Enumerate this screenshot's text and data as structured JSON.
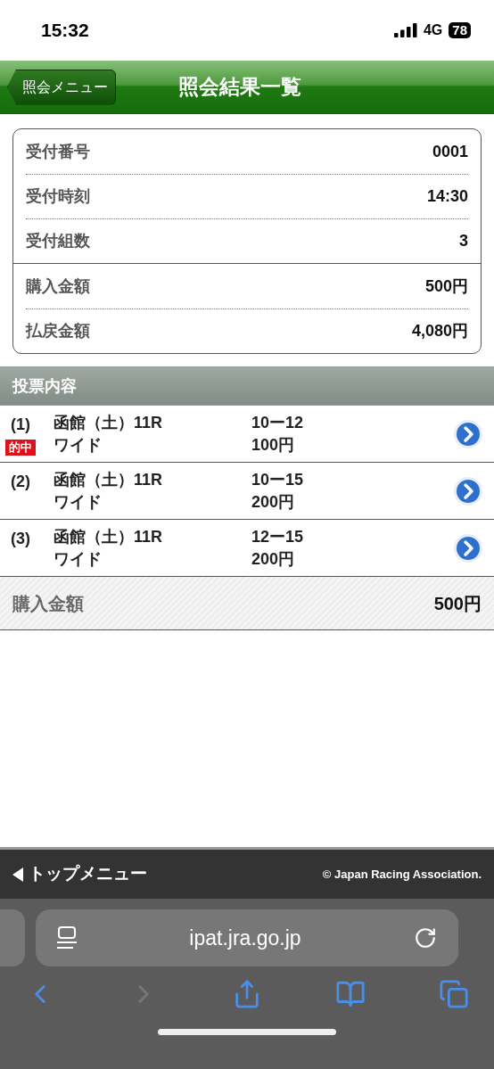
{
  "status_bar": {
    "time": "15:32",
    "network": "4G",
    "battery": "78"
  },
  "header": {
    "back_button": "照会メニュー",
    "title": "照会結果一覧"
  },
  "summary": {
    "groups": [
      [
        {
          "label": "受付番号",
          "value": "0001"
        },
        {
          "label": "受付時刻",
          "value": "14:30"
        },
        {
          "label": "受付組数",
          "value": "3"
        }
      ],
      [
        {
          "label": "購入金額",
          "value": "500円"
        },
        {
          "label": "払戻金額",
          "value": "4,080円"
        }
      ]
    ]
  },
  "bets": {
    "title": "投票内容",
    "items": [
      {
        "number": "(1)",
        "race": "函館（土）11R",
        "bet_type": "ワイド",
        "combination": "10ー12",
        "amount": "100円",
        "badge": "的中"
      },
      {
        "number": "(2)",
        "race": "函館（土）11R",
        "bet_type": "ワイド",
        "combination": "10ー15",
        "amount": "200円"
      },
      {
        "number": "(3)",
        "race": "函館（土）11R",
        "bet_type": "ワイド",
        "combination": "12ー15",
        "amount": "200円"
      }
    ],
    "total": {
      "label": "購入金額",
      "value": "500円"
    }
  },
  "footer": {
    "menu_link": "トップメニュー",
    "copyright": "© Japan Racing Association."
  },
  "browser": {
    "url": "ipat.jra.go.jp",
    "back_disabled": false,
    "forward_disabled": true
  }
}
